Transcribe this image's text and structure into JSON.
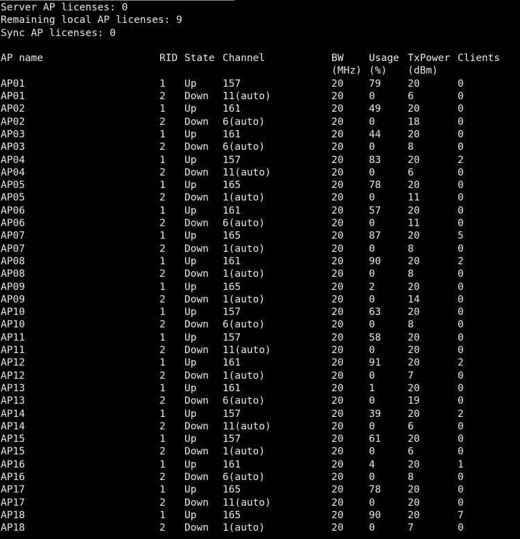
{
  "header": {
    "server_licenses": "Server AP licenses: 0",
    "remaining_licenses": "Remaining local AP licenses: 9",
    "sync_licenses": "Sync AP licenses: 0"
  },
  "table": {
    "columns": {
      "name": "AP name",
      "rid": "RID",
      "state": "State",
      "channel": "Channel",
      "bw": "BW",
      "bw_unit": "(MHz)",
      "usage": "Usage",
      "usage_unit": "(%)",
      "txpower": "TxPower",
      "txpower_unit": "(dBm)",
      "clients": "Clients"
    },
    "rows": [
      [
        "AP01",
        "1",
        "Up",
        "157",
        "20",
        "79",
        "20",
        "0"
      ],
      [
        "AP01",
        "2",
        "Down",
        "11(auto)",
        "20",
        "0",
        "6",
        "0"
      ],
      [
        "AP02",
        "1",
        "Up",
        "161",
        "20",
        "49",
        "20",
        "0"
      ],
      [
        "AP02",
        "2",
        "Down",
        "6(auto)",
        "20",
        "0",
        "18",
        "0"
      ],
      [
        "AP03",
        "1",
        "Up",
        "161",
        "20",
        "44",
        "20",
        "0"
      ],
      [
        "AP03",
        "2",
        "Down",
        "6(auto)",
        "20",
        "0",
        "8",
        "0"
      ],
      [
        "AP04",
        "1",
        "Up",
        "157",
        "20",
        "83",
        "20",
        "2"
      ],
      [
        "AP04",
        "2",
        "Down",
        "11(auto)",
        "20",
        "0",
        "6",
        "0"
      ],
      [
        "AP05",
        "1",
        "Up",
        "165",
        "20",
        "78",
        "20",
        "0"
      ],
      [
        "AP05",
        "2",
        "Down",
        "1(auto)",
        "20",
        "0",
        "11",
        "0"
      ],
      [
        "AP06",
        "1",
        "Up",
        "161",
        "20",
        "57",
        "20",
        "0"
      ],
      [
        "AP06",
        "2",
        "Down",
        "6(auto)",
        "20",
        "0",
        "11",
        "0"
      ],
      [
        "AP07",
        "1",
        "Up",
        "165",
        "20",
        "87",
        "20",
        "5"
      ],
      [
        "AP07",
        "2",
        "Down",
        "1(auto)",
        "20",
        "0",
        "8",
        "0"
      ],
      [
        "AP08",
        "1",
        "Up",
        "161",
        "20",
        "90",
        "20",
        "2"
      ],
      [
        "AP08",
        "2",
        "Down",
        "1(auto)",
        "20",
        "0",
        "8",
        "0"
      ],
      [
        "AP09",
        "1",
        "Up",
        "165",
        "20",
        "2",
        "20",
        "0"
      ],
      [
        "AP09",
        "2",
        "Down",
        "1(auto)",
        "20",
        "0",
        "14",
        "0"
      ],
      [
        "AP10",
        "1",
        "Up",
        "157",
        "20",
        "63",
        "20",
        "0"
      ],
      [
        "AP10",
        "2",
        "Down",
        "6(auto)",
        "20",
        "0",
        "8",
        "0"
      ],
      [
        "AP11",
        "1",
        "Up",
        "157",
        "20",
        "58",
        "20",
        "0"
      ],
      [
        "AP11",
        "2",
        "Down",
        "11(auto)",
        "20",
        "0",
        "20",
        "0"
      ],
      [
        "AP12",
        "1",
        "Up",
        "161",
        "20",
        "91",
        "20",
        "2"
      ],
      [
        "AP12",
        "2",
        "Down",
        "1(auto)",
        "20",
        "0",
        "7",
        "0"
      ],
      [
        "AP13",
        "1",
        "Up",
        "161",
        "20",
        "1",
        "20",
        "0"
      ],
      [
        "AP13",
        "2",
        "Down",
        "6(auto)",
        "20",
        "0",
        "19",
        "0"
      ],
      [
        "AP14",
        "1",
        "Up",
        "157",
        "20",
        "39",
        "20",
        "2"
      ],
      [
        "AP14",
        "2",
        "Down",
        "11(auto)",
        "20",
        "0",
        "6",
        "0"
      ],
      [
        "AP15",
        "1",
        "Up",
        "157",
        "20",
        "61",
        "20",
        "0"
      ],
      [
        "AP15",
        "2",
        "Down",
        "1(auto)",
        "20",
        "0",
        "6",
        "0"
      ],
      [
        "AP16",
        "1",
        "Up",
        "161",
        "20",
        "4",
        "20",
        "1"
      ],
      [
        "AP16",
        "2",
        "Down",
        "6(auto)",
        "20",
        "0",
        "8",
        "0"
      ],
      [
        "AP17",
        "1",
        "Up",
        "165",
        "20",
        "78",
        "20",
        "0"
      ],
      [
        "AP17",
        "2",
        "Down",
        "11(auto)",
        "20",
        "0",
        "20",
        "0"
      ],
      [
        "AP18",
        "1",
        "Up",
        "165",
        "20",
        "90",
        "20",
        "7"
      ],
      [
        "AP18",
        "2",
        "Down",
        "1(auto)",
        "20",
        "0",
        "7",
        "0"
      ]
    ]
  },
  "colors": {
    "background": "#000000",
    "text": "#e8e8e8"
  }
}
